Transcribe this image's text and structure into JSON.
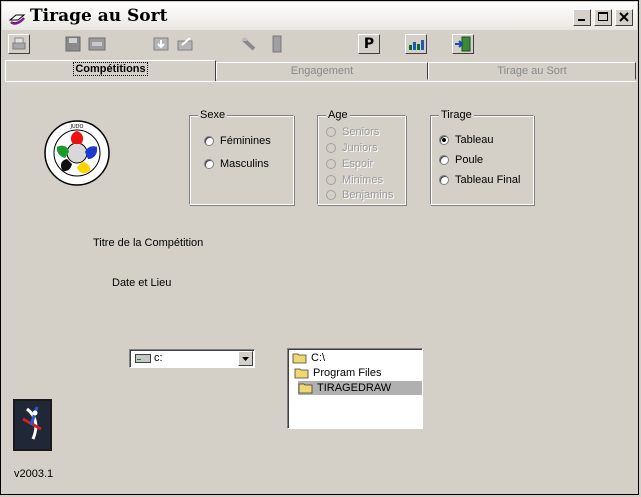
{
  "window": {
    "title": "Tirage au Sort"
  },
  "toolbar": {
    "buttons": [
      {
        "icon": "print-icon"
      },
      {
        "icon": "save-icon"
      },
      {
        "icon": "card-icon"
      },
      {
        "icon": "import-icon"
      },
      {
        "icon": "export-icon"
      },
      {
        "icon": "edit-icon"
      },
      {
        "icon": "delete-icon"
      },
      {
        "icon": "p-letter-icon",
        "text": "P"
      },
      {
        "icon": "chart-icon"
      },
      {
        "icon": "exit-door-icon"
      }
    ]
  },
  "tabs": [
    "Compétitions",
    "Engagement",
    "Tirage au Sort"
  ],
  "sexe": {
    "legend": "Sexe",
    "options": [
      "Féminines",
      "Masculins"
    ]
  },
  "age": {
    "legend": "Age",
    "options": [
      "Seniors",
      "Juniors",
      "Espoir",
      "Minimes",
      "Benjamins"
    ]
  },
  "tirage": {
    "legend": "Tirage",
    "options": [
      "Tableau",
      "Poule",
      "Tableau Final"
    ],
    "selected": "Tableau"
  },
  "labels": {
    "titre": "Titre de la Compétition",
    "date": "Date et Lieu"
  },
  "drive": {
    "value": "c:"
  },
  "folders": [
    "C:\\",
    "Program Files",
    "TIRAGEDRAW"
  ],
  "version": "v2003.1",
  "colors": {
    "face": "#d4d0c8",
    "selection": "#b0b0b0"
  }
}
